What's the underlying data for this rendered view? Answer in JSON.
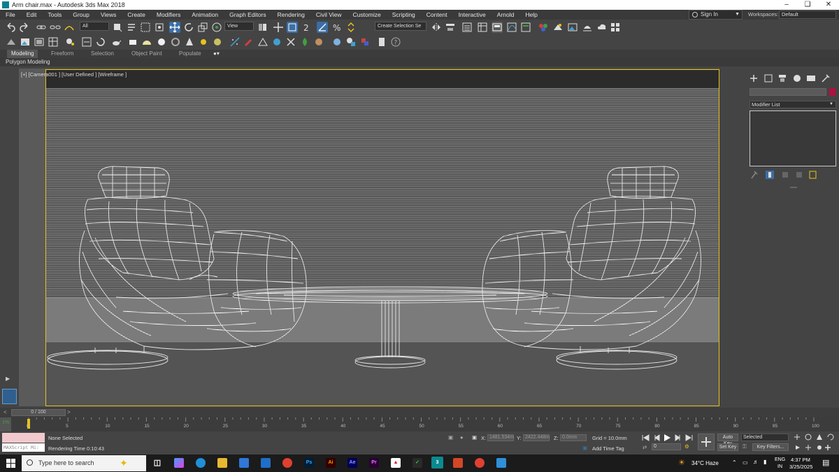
{
  "window": {
    "title": "Arm chair.max - Autodesk 3ds Max 2018"
  },
  "menu": [
    "File",
    "Edit",
    "Tools",
    "Group",
    "Views",
    "Create",
    "Modifiers",
    "Animation",
    "Graph Editors",
    "Rendering",
    "Civil View",
    "Customize",
    "Scripting",
    "Content",
    "Interactive",
    "Arnold",
    "Help"
  ],
  "account": {
    "sign_in": "Sign In",
    "workspaces_label": "Workspaces:",
    "workspace_value": "Default"
  },
  "toolbar": {
    "filter_value": "All",
    "ref_coord_value": "View",
    "selection_set_placeholder": "Create Selection Se"
  },
  "ribbon": {
    "tabs": [
      "Modeling",
      "Freeform",
      "Selection",
      "Object Paint",
      "Populate"
    ],
    "active_tab": "Modeling",
    "panel_label": "Polygon Modeling"
  },
  "viewport": {
    "label": "[+] [Camera001 ] [User Defined ] [Wireframe ]"
  },
  "command_panel": {
    "modifier_list": "Modifier List"
  },
  "timeline": {
    "slider_text": "0 / 100",
    "ticks": [
      "0",
      "5",
      "10",
      "15",
      "20",
      "25",
      "30",
      "35",
      "40",
      "45",
      "50",
      "55",
      "60",
      "65",
      "70",
      "75",
      "80",
      "85",
      "90",
      "95",
      "100"
    ]
  },
  "status": {
    "maxscript": "MAXScript Mi:",
    "selection": "None Selected",
    "render_time": "Rendering Time  0:10:43",
    "x_label": "X:",
    "x_value": "1481.534m",
    "y_label": "Y:",
    "y_value": "2422.448m",
    "z_label": "Z:",
    "z_value": "0.0mm",
    "grid": "Grid = 10.0mm",
    "add_time_tag": "Add Time Tag",
    "auto_key": "Auto Key",
    "set_key": "Set Key",
    "key_mode_value": "Selected",
    "key_filters": "Key Filters...",
    "frame_value": "0"
  },
  "taskbar": {
    "search_placeholder": "Type here to search",
    "weather": "34°C  Haze",
    "lang": "ENG",
    "lang_region": "IN",
    "time": "4:37 PM",
    "date": "3/25/2025",
    "apps": [
      "Ps",
      "Ai",
      "Ae",
      "Pr",
      "3"
    ]
  },
  "colors": {
    "accent": "#e8c21c",
    "selected_tool": "#3b6ea5",
    "wire": "#e8e8e8"
  }
}
